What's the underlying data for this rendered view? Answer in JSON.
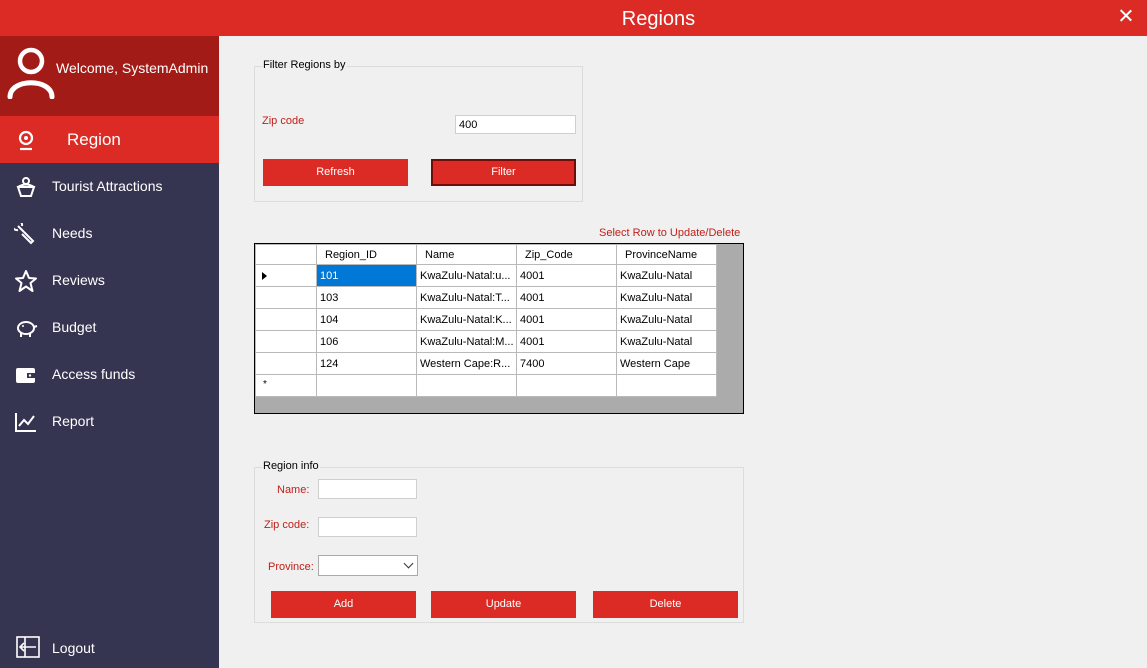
{
  "window": {
    "title": "Regions"
  },
  "user": {
    "welcome": "Welcome, SystemAdmin"
  },
  "nav": [
    {
      "label": "Region",
      "icon": "map-pin-icon"
    },
    {
      "label": "Tourist Attractions",
      "icon": "attraction-icon"
    },
    {
      "label": "Needs",
      "icon": "wrench-icon"
    },
    {
      "label": "Reviews",
      "icon": "star-icon"
    },
    {
      "label": "Budget",
      "icon": "piggy-bank-icon"
    },
    {
      "label": "Access funds",
      "icon": "wallet-icon"
    },
    {
      "label": "Report",
      "icon": "chart-icon"
    }
  ],
  "logout": {
    "label": "Logout"
  },
  "filter": {
    "legend": "Filter Regions by",
    "zip_label": "Zip code",
    "zip_value": "400",
    "refresh_label": "Refresh",
    "filter_label": "Filter"
  },
  "grid": {
    "hint": "Select Row to Update/Delete",
    "columns": [
      "Region_ID",
      "Name",
      "Zip_Code",
      "ProvinceName"
    ],
    "rows": [
      [
        "101",
        "KwaZulu-Natal:u...",
        "4001",
        "KwaZulu-Natal"
      ],
      [
        "103",
        "KwaZulu-Natal:T...",
        "4001",
        "KwaZulu-Natal"
      ],
      [
        "104",
        "KwaZulu-Natal:K...",
        "4001",
        "KwaZulu-Natal"
      ],
      [
        "106",
        "KwaZulu-Natal:M...",
        "4001",
        "KwaZulu-Natal"
      ],
      [
        "124",
        "Western Cape:R...",
        "7400",
        "Western Cape"
      ]
    ],
    "new_row_marker": "*"
  },
  "region_info": {
    "legend": "Region info",
    "name_label": "Name:",
    "name_value": "",
    "zip_label": "Zip code:",
    "zip_value": "",
    "province_label": "Province:",
    "province_value": "",
    "add_label": "Add",
    "update_label": "Update",
    "delete_label": "Delete"
  },
  "colors": {
    "accent": "#dc2b24",
    "sidebar": "#363551",
    "user_panel": "#a31b16",
    "selection": "#0078d7"
  }
}
